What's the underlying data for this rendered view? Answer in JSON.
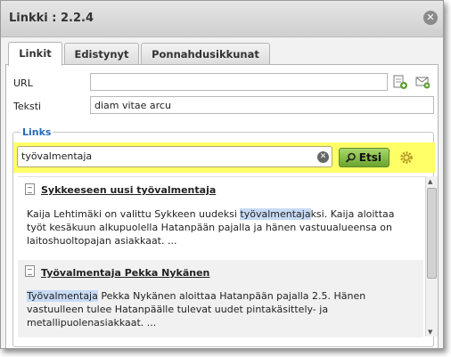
{
  "dialog": {
    "title": "Linkki : 2.2.4"
  },
  "tabs": [
    {
      "label": "Linkit"
    },
    {
      "label": "Edistynyt"
    },
    {
      "label": "Ponnahdusikkunat"
    }
  ],
  "form": {
    "url_label": "URL",
    "url_value": "",
    "text_label": "Teksti",
    "text_value": "diam vitae arcu"
  },
  "links_section": {
    "legend": "Links",
    "search_value": "työvalmentaja",
    "search_button": "Etsi"
  },
  "results": [
    {
      "title": "Sykkeeseen uusi työvalmentaja",
      "lines": [
        {
          "before": "Kaija Lehtimäki on valittu Sykkeen uudeksi ",
          "highlight": "työvalmentaja",
          "after": "ksi. Kaija aloittaa"
        },
        {
          "before": "työt kesäkuun alkupuolella Hatanpään pajalla ja hänen vastuualueensa on",
          "highlight": "",
          "after": ""
        },
        {
          "before": "laitoshuoltopajan asiakkaat.  ...",
          "highlight": "",
          "after": ""
        }
      ]
    },
    {
      "title": "Työvalmentaja Pekka Nykänen",
      "lines": [
        {
          "before": "",
          "highlight": "Työvalmentaja",
          "after": " Pekka Nykänen aloittaa Hatanpään pajalla 2.5. Hänen"
        },
        {
          "before": "vastuulleen tulee Hatanpäälle tulevat uudet pintakäsittely- ja",
          "highlight": "",
          "after": ""
        },
        {
          "before": "metallipuolenasiakkaat.  ...",
          "highlight": "",
          "after": ""
        }
      ]
    }
  ],
  "colors": {
    "legend": "#2a6ab8",
    "search_highlight": "#ffff66",
    "button_green": "#6aa32e",
    "match_highlight": "#c7dbf5"
  },
  "icons": {
    "close": "close-icon",
    "browse": "browse-server-icon",
    "email": "email-link-icon",
    "search": "magnifier-icon",
    "settings": "gear-icon",
    "document": "document-icon"
  }
}
